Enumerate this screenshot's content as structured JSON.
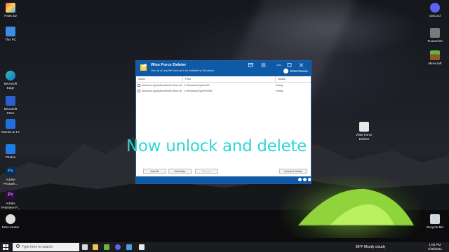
{
  "desktop_icons": {
    "paint3d": "Paint 3D",
    "thispc": "This PC",
    "edge": "Microsoft Edge",
    "store": "Microsoft Store",
    "movies": "Movies & TV",
    "photos": "Photos",
    "photoshop": "Adobe Photosh...",
    "premiere": "Adobe Premiere P...",
    "mineimator": "Mine-imator",
    "discord": "Discord",
    "tlauncher": "TLauncher",
    "minecraft": "Minecraft",
    "wfd": "Wise Force Deleter",
    "recycle": "Recycle Bin"
  },
  "overlay": {
    "caption": "Now unlock and delete"
  },
  "window": {
    "title": "Wise Force Deleter",
    "subtitle": "Get rid of any file that can't be deleted by Windows",
    "brand": "WiseCleaner",
    "columns": {
      "name": "Name",
      "path": "Path",
      "status": "Status"
    },
    "rows": [
      {
        "name": "Windows.ApplicationModel.Store.dll",
        "path": "C:\\Windows\\System32\\",
        "status": "Ready"
      },
      {
        "name": "Windows.ApplicationModel.Store.dll",
        "path": "C:\\Windows\\SysWOW64\\",
        "status": "Ready"
      }
    ],
    "buttons": {
      "add_file": "Add file",
      "add_folder": "Add folder",
      "remove": "Remove",
      "unlock_delete": "Unlock & Delete"
    }
  },
  "taskbar": {
    "search_placeholder": "Type here to search",
    "weather": "89°F  Mostly cloudy",
    "time": "1:06 PM",
    "date": "7/28/2021"
  },
  "colors": {
    "titlebar": "#0f5aa7",
    "overlay_text": "#2fd6d6"
  }
}
